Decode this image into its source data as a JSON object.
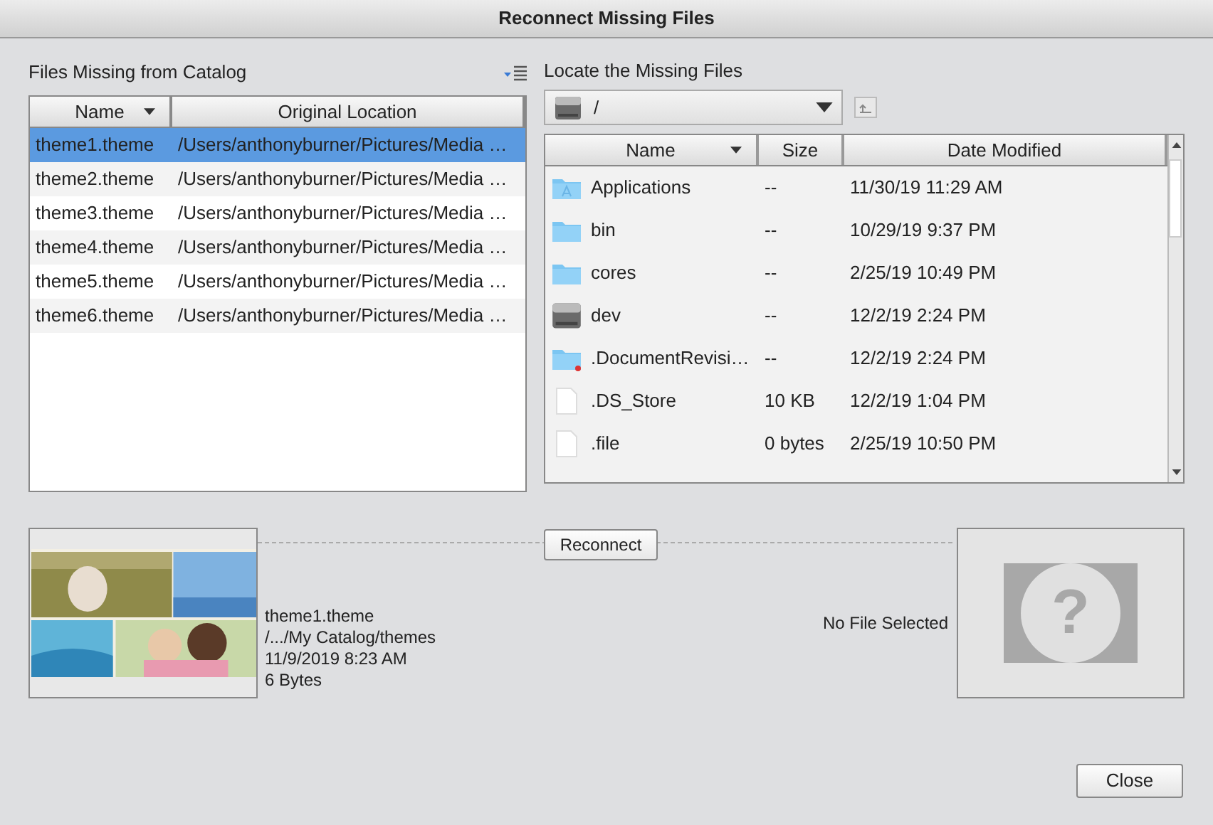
{
  "window": {
    "title": "Reconnect Missing Files"
  },
  "missing_files": {
    "title": "Files Missing from Catalog",
    "columns": [
      "Name",
      "Original Location"
    ],
    "rows": [
      {
        "name": "theme1.theme",
        "location": "/Users/anthonyburner/Pictures/Media …",
        "selected": true
      },
      {
        "name": "theme2.theme",
        "location": "/Users/anthonyburner/Pictures/Media …",
        "selected": false
      },
      {
        "name": "theme3.theme",
        "location": "/Users/anthonyburner/Pictures/Media …",
        "selected": false
      },
      {
        "name": "theme4.theme",
        "location": "/Users/anthonyburner/Pictures/Media …",
        "selected": false
      },
      {
        "name": "theme5.theme",
        "location": "/Users/anthonyburner/Pictures/Media …",
        "selected": false
      },
      {
        "name": "theme6.theme",
        "location": "/Users/anthonyburner/Pictures/Media …",
        "selected": false
      }
    ]
  },
  "locate": {
    "title": "Locate the Missing Files",
    "path": "/",
    "columns": [
      "Name",
      "Size",
      "Date Modified"
    ],
    "rows": [
      {
        "kind": "apps",
        "name": "Applications",
        "size": "--",
        "date": "11/30/19 11:29 AM"
      },
      {
        "kind": "folder",
        "name": "bin",
        "size": "--",
        "date": "10/29/19 9:37 PM"
      },
      {
        "kind": "folder",
        "name": "cores",
        "size": "--",
        "date": "2/25/19 10:49 PM"
      },
      {
        "kind": "disk",
        "name": "dev",
        "size": "--",
        "date": "12/2/19 2:24 PM"
      },
      {
        "kind": "locked",
        "name": ".DocumentRevisi…",
        "size": "--",
        "date": "12/2/19 2:24 PM"
      },
      {
        "kind": "file",
        "name": ".DS_Store",
        "size": "10 KB",
        "date": "12/2/19 1:04 PM"
      },
      {
        "kind": "file",
        "name": ".file",
        "size": "0 bytes",
        "date": "2/25/19 10:50 PM"
      }
    ]
  },
  "preview": {
    "info": [
      "theme1.theme",
      "/.../My Catalog/themes",
      "11/9/2019 8:23 AM",
      "6 Bytes"
    ],
    "reconnect": "Reconnect",
    "target_label": "No File Selected",
    "target_icon": "?"
  },
  "buttons": [
    "Close"
  ]
}
